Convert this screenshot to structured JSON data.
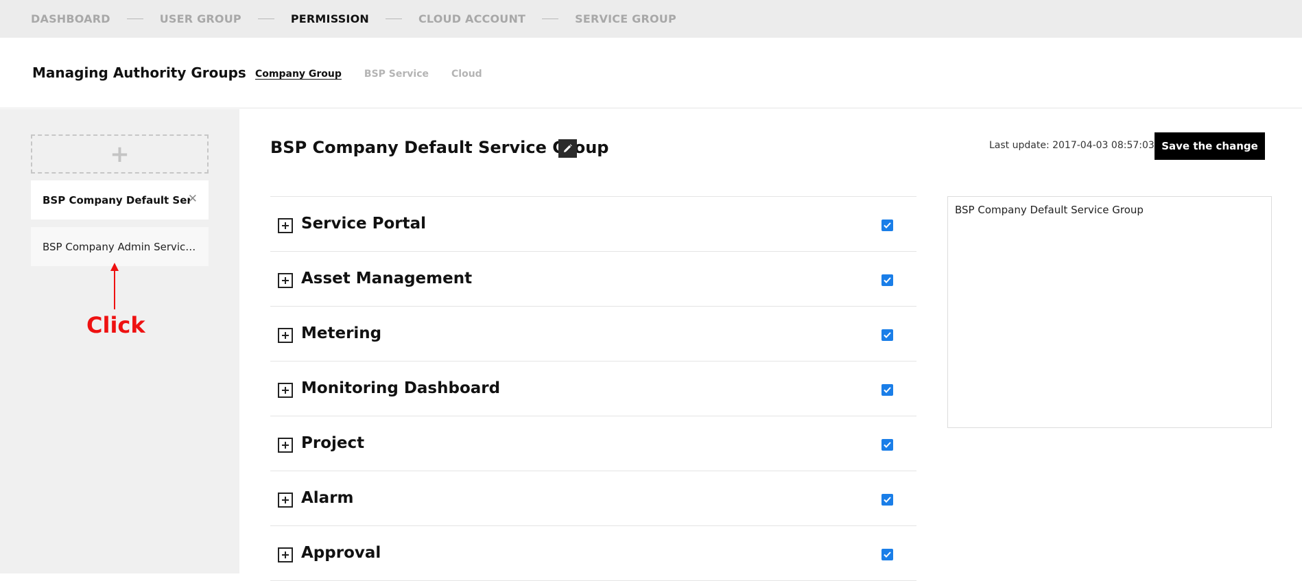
{
  "top_nav": {
    "steps": [
      {
        "label": "DASHBOARD",
        "active": false
      },
      {
        "label": "USER GROUP",
        "active": false
      },
      {
        "label": "PERMISSION",
        "active": true
      },
      {
        "label": "CLOUD ACCOUNT",
        "active": false
      },
      {
        "label": "SERVICE GROUP",
        "active": false
      }
    ]
  },
  "header": {
    "title": "Managing Authority Groups",
    "tabs": [
      {
        "label": "Company Group",
        "active": true
      },
      {
        "label": "BSP Service",
        "active": false
      },
      {
        "label": "Cloud",
        "active": false
      }
    ]
  },
  "sidebar": {
    "add_icon": "+",
    "items": [
      {
        "label": "BSP Company Default Service Group",
        "selected": true,
        "close_icon": "✕"
      },
      {
        "label": "BSP Company Admin Service Group",
        "selected": false
      }
    ],
    "annotation": {
      "text": "Click",
      "color": "#ee1111"
    }
  },
  "main": {
    "group_title": "BSP Company Default Service Group",
    "last_update": "Last update: 2017-04-03 08:57:03",
    "save_label": "Save the change",
    "description": "BSP Company Default Service Group",
    "permissions": [
      {
        "label": "Service Portal",
        "checked": true
      },
      {
        "label": "Asset Management",
        "checked": true
      },
      {
        "label": "Metering",
        "checked": true
      },
      {
        "label": "Monitoring Dashboard",
        "checked": true
      },
      {
        "label": "Project",
        "checked": true
      },
      {
        "label": "Alarm",
        "checked": true
      },
      {
        "label": "Approval",
        "checked": true
      }
    ]
  },
  "colors": {
    "accent": "#1a7ee8",
    "topnav_bg": "#ececec",
    "sidebar_bg": "#f0f0f0",
    "primary_button": "#000000"
  }
}
